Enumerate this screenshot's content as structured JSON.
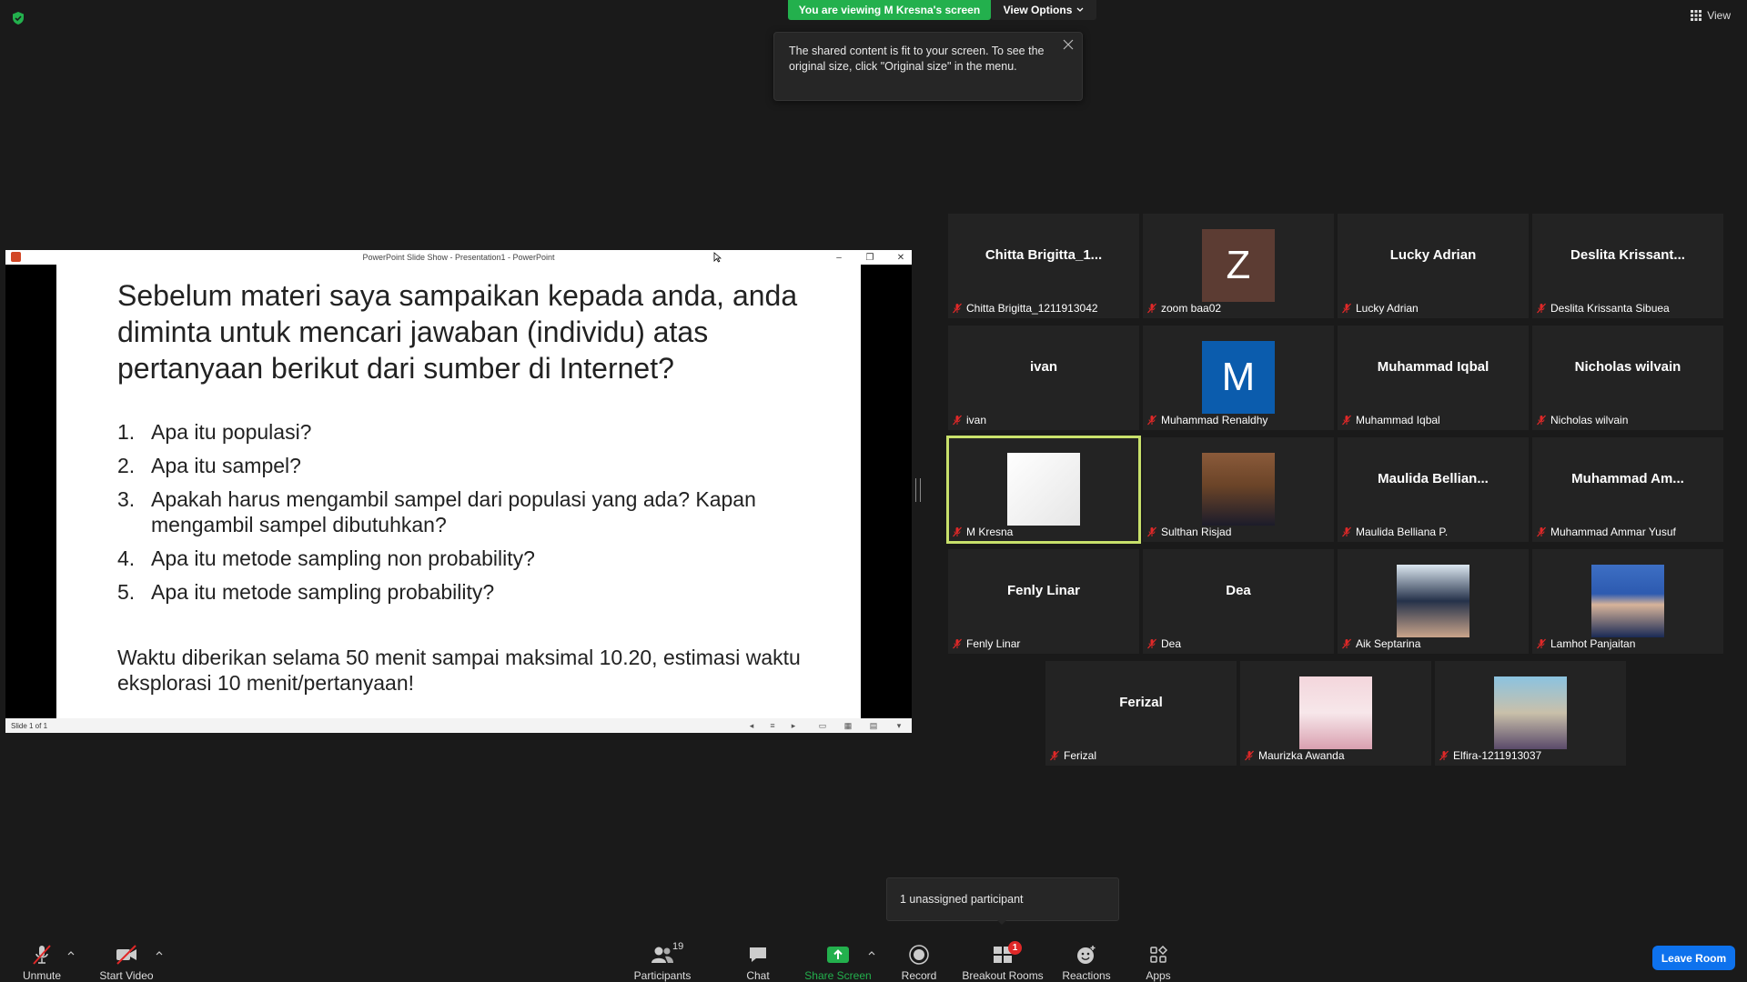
{
  "top": {
    "viewing_banner": "You are viewing M Kresna's screen",
    "view_options": "View Options",
    "view_label": "View"
  },
  "notice": {
    "text": "The shared content is fit to your screen. To see the original size, click \"Original size\" in the menu."
  },
  "ppt": {
    "window_title": "PowerPoint Slide Show  -  Presentation1 - PowerPoint",
    "status_slide": "Slide 1 of 1",
    "heading": "Sebelum materi saya sampaikan kepada anda, anda diminta untuk mencari jawaban (individu) atas pertanyaan berikut dari sumber di Internet?",
    "questions": [
      {
        "num": "1.",
        "text": "Apa itu populasi?"
      },
      {
        "num": "2.",
        "text": "Apa itu sampel?"
      },
      {
        "num": "3.",
        "text": "Apakah harus mengambil sampel dari populasi yang ada? Kapan mengambil sampel dibutuhkan?"
      },
      {
        "num": "4.",
        "text": "Apa itu metode sampling non probability?"
      },
      {
        "num": "5.",
        "text": "Apa itu metode sampling probability?"
      }
    ],
    "footer": "Waktu diberikan selama 50 menit sampai maksimal 10.20, estimasi waktu eksplorasi 10 menit/pertanyaan!"
  },
  "participants": [
    {
      "big": "Chitta  Brigitta_1...",
      "name": "Chitta Brigitta_1211913042"
    },
    {
      "big": "Z",
      "name": "zoom baa02",
      "avatar_color": "#5c3c33"
    },
    {
      "big": "Lucky Adrian",
      "name": "Lucky Adrian"
    },
    {
      "big": "Deslita  Krissant...",
      "name": "Deslita Krissanta Sibuea"
    },
    {
      "big": "ivan",
      "name": "ivan"
    },
    {
      "big": "M",
      "name": "Muhammad Renaldhy",
      "avatar_color": "#0b5cad"
    },
    {
      "big": "Muhammad Iqbal",
      "name": "Muhammad Iqbal"
    },
    {
      "big": "Nicholas wilvain",
      "name": "Nicholas wilvain"
    },
    {
      "big": "",
      "name": "M Kresna",
      "active": true
    },
    {
      "big": "",
      "name": "Sulthan Risjad"
    },
    {
      "big": "Maulida  Bellian...",
      "name": "Maulida Belliana P."
    },
    {
      "big": "Muhammad  Am...",
      "name": "Muhammad Ammar Yusuf"
    },
    {
      "big": "Fenly Linar",
      "name": "Fenly Linar"
    },
    {
      "big": "Dea",
      "name": "Dea"
    },
    {
      "big": "",
      "name": "Aik Septarina"
    },
    {
      "big": "",
      "name": "Lamhot Panjaitan"
    },
    {
      "big": "Ferizal",
      "name": "Ferizal"
    },
    {
      "big": "",
      "name": "Maurizka Awanda"
    },
    {
      "big": "",
      "name": "Elfira-1211913037"
    }
  ],
  "tooltip": "1 unassigned participant",
  "toolbar": {
    "unmute": "Unmute",
    "start_video": "Start Video",
    "participants": "Participants",
    "participants_count": "19",
    "chat": "Chat",
    "share_screen": "Share Screen",
    "record": "Record",
    "breakout_rooms": "Breakout Rooms",
    "breakout_badge": "1",
    "reactions": "Reactions",
    "apps": "Apps",
    "leave": "Leave Room"
  },
  "colors": {
    "banner_green": "#23b04d",
    "active_speaker": "#c8e06b",
    "leave_blue": "#0e72ed",
    "muted_red": "#e02828"
  }
}
